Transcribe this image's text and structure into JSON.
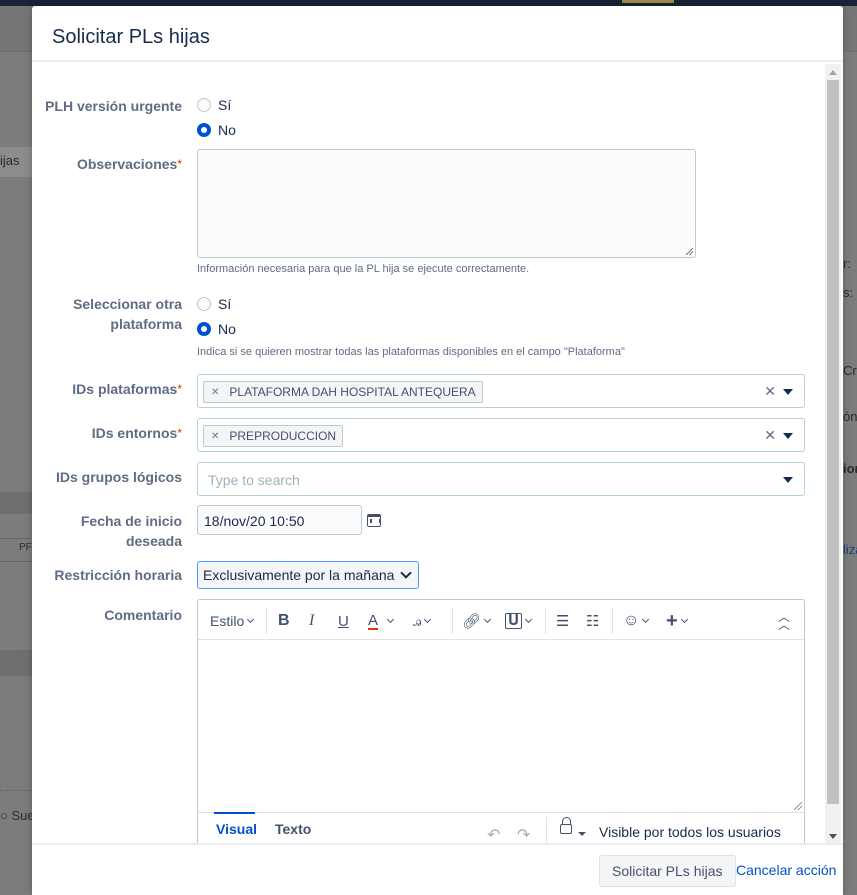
{
  "background": {
    "fragments": [
      "ijas",
      "r:",
      "s:",
      "Cre",
      "ón",
      "ion",
      "PF",
      "liza",
      "Sue"
    ]
  },
  "modal": {
    "title": "Solicitar PLs hijas",
    "fields": {
      "urgent": {
        "label": "PLH versión urgente",
        "options": [
          "Sí",
          "No"
        ],
        "selected": "No"
      },
      "observaciones": {
        "label": "Observaciones",
        "required_mark": "*",
        "value": "",
        "help": "Información necesaria para que la PL hija se ejecute correctamente."
      },
      "otra_plataforma": {
        "label": "Seleccionar otra plataforma",
        "options": [
          "Sí",
          "No"
        ],
        "selected": "No",
        "help": "Indica si se quieren mostrar todas las plataformas disponibles en el campo \"Plataforma\""
      },
      "ids_plataformas": {
        "label": "IDs plataformas",
        "required_mark": "*",
        "tags": [
          "PLATAFORMA DAH HOSPITAL ANTEQUERA"
        ]
      },
      "ids_entornos": {
        "label": "IDs entornos",
        "required_mark": "*",
        "tags": [
          "PREPRODUCCION"
        ]
      },
      "ids_grupos": {
        "label": "IDs grupos lógicos",
        "placeholder": "Type to search"
      },
      "fecha_inicio": {
        "label": "Fecha de inicio deseada",
        "value": "18/nov/20 10:50"
      },
      "restriccion": {
        "label": "Restricción horaria",
        "value": "Exclusivamente por la mañana"
      },
      "comentario": {
        "label": "Comentario",
        "toolbar": {
          "style_label": "Estilo",
          "bold": "B",
          "italic": "I",
          "underline": "U",
          "text_color": "A",
          "text_color_value": "#de350b"
        },
        "tabs": [
          "Visual",
          "Texto"
        ],
        "active_tab": "Visual",
        "visibility": "Visible por todos los usuarios"
      }
    },
    "footer": {
      "submit_label": "Solicitar PLs hijas",
      "cancel_label": "Cancelar acción"
    }
  }
}
